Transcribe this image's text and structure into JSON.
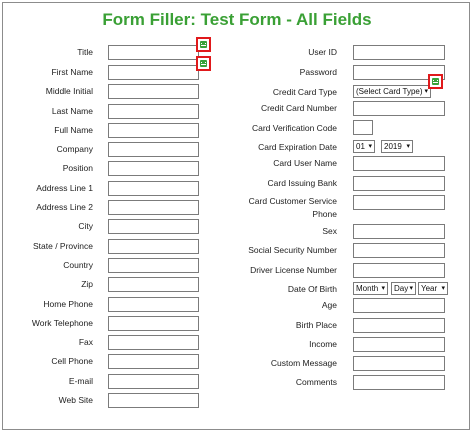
{
  "title": "Form Filler: Test Form - All Fields",
  "icon": "form-filler-icon",
  "left_fields": [
    {
      "label": "Title"
    },
    {
      "label": "First Name"
    },
    {
      "label": "Middle Initial"
    },
    {
      "label": "Last Name"
    },
    {
      "label": "Full Name"
    },
    {
      "label": "Company"
    },
    {
      "label": "Position"
    },
    {
      "label": "Address Line 1"
    },
    {
      "label": "Address Line 2"
    },
    {
      "label": "City"
    },
    {
      "label": "State / Province"
    },
    {
      "label": "Country"
    },
    {
      "label": "Zip"
    },
    {
      "label": "Home Phone"
    },
    {
      "label": "Work Telephone"
    },
    {
      "label": "Fax"
    },
    {
      "label": "Cell Phone"
    },
    {
      "label": "E-mail"
    },
    {
      "label": "Web Site"
    }
  ],
  "right_fields": {
    "user_id": "User ID",
    "password": "Password",
    "credit_card_type": "Credit Card Type",
    "credit_card_type_value": "(Select Card Type)",
    "credit_card_number": "Credit Card Number",
    "card_verification_code": "Card Verification Code",
    "card_expiration_date": "Card Expiration Date",
    "exp_month_value": "01",
    "exp_year_value": "2019",
    "card_user_name": "Card User Name",
    "card_issuing_bank": "Card Issuing Bank",
    "card_customer_service_phone": "Card Customer Service Phone",
    "sex": "Sex",
    "social_security_number": "Social Security Number",
    "driver_license_number": "Driver License Number",
    "date_of_birth": "Date Of Birth",
    "dob_month_value": "Month",
    "dob_day_value": "Day",
    "dob_year_value": "Year",
    "age": "Age",
    "birth_place": "Birth Place",
    "income": "Income",
    "custom_message": "Custom Message",
    "comments": "Comments"
  },
  "colors": {
    "title": "#3aa035",
    "badge_border": "#e0191b",
    "badge_icon": "#37a23a"
  }
}
